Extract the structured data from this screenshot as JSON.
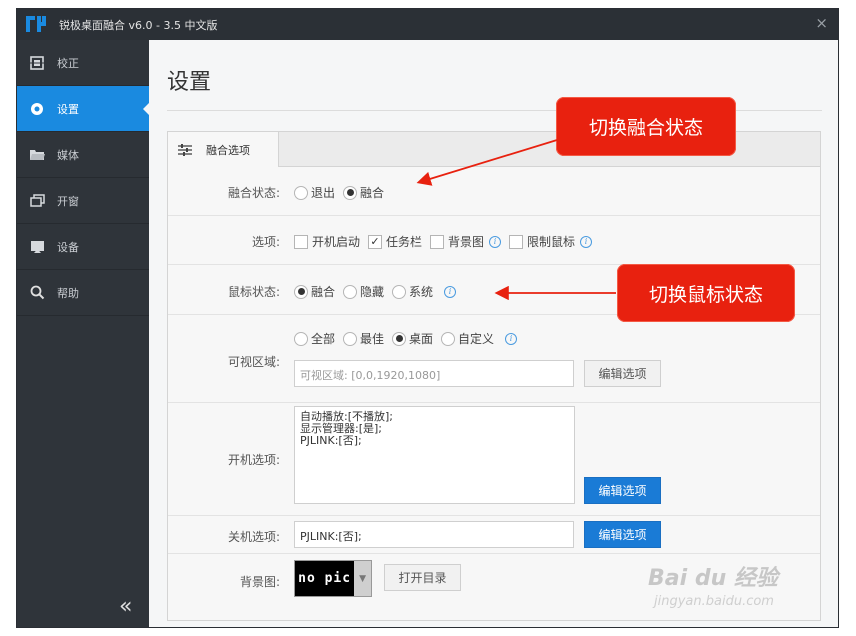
{
  "window": {
    "title": "锐极桌面融合 v6.0 - 3.5 中文版",
    "close_glyph": "×"
  },
  "sidebar": {
    "items": [
      {
        "label": "校正",
        "icon": "calibrate-icon"
      },
      {
        "label": "设置",
        "icon": "gear-icon",
        "active": true
      },
      {
        "label": "媒体",
        "icon": "folder-icon"
      },
      {
        "label": "开窗",
        "icon": "window-icon"
      },
      {
        "label": "设备",
        "icon": "device-icon"
      },
      {
        "label": "帮助",
        "icon": "search-icon"
      }
    ],
    "collapse_glyph": "«"
  },
  "page": {
    "title": "设置"
  },
  "tab": {
    "label": "融合选项"
  },
  "fusion_state": {
    "label": "融合状态:",
    "options": [
      "退出",
      "融合"
    ],
    "selected": "融合"
  },
  "options": {
    "label": "选项:",
    "items": [
      {
        "label": "开机启动",
        "checked": false
      },
      {
        "label": "任务栏",
        "checked": true
      },
      {
        "label": "背景图",
        "checked": false,
        "info": true
      },
      {
        "label": "限制鼠标",
        "checked": false,
        "info": true
      }
    ],
    "check_glyph": "✓"
  },
  "mouse_state": {
    "label": "鼠标状态:",
    "options": [
      "融合",
      "隐藏",
      "系统"
    ],
    "selected": "融合"
  },
  "visible_area": {
    "label": "可视区域:",
    "options": [
      "全部",
      "最佳",
      "桌面",
      "自定义"
    ],
    "selected": "桌面",
    "value": "可视区域: [0,0,1920,1080]",
    "button": "编辑选项"
  },
  "boot_options": {
    "label": "开机选项:",
    "lines": [
      "自动播放:[不播放];",
      "显示管理器:[是];",
      "PJLINK:[否];"
    ],
    "button": "编辑选项"
  },
  "shutdown_options": {
    "label": "关机选项:",
    "value": "PJLINK:[否];",
    "button": "编辑选项"
  },
  "background": {
    "label": "背景图:",
    "thumb_text": "no pic",
    "button": "打开目录"
  },
  "callouts": {
    "fusion": "切换融合状态",
    "mouse": "切换鼠标状态"
  },
  "watermark": {
    "main": "Bai du 经验",
    "sub": "jingyan.baidu.com"
  },
  "colors": {
    "accent": "#1a8ae0",
    "sidebar": "#2f343a",
    "titlebar": "#2b3036",
    "callout": "#e8210f",
    "button_blue": "#1a7bd6"
  }
}
